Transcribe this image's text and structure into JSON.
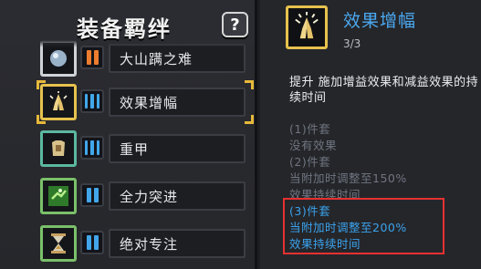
{
  "panel": {
    "title": "装备羁绊",
    "help_label": "?"
  },
  "bonds": [
    {
      "name": "大山蹒之难",
      "icon": "silver-orb-icon",
      "bar_color": "#ee7c2e",
      "selected": false
    },
    {
      "name": "效果增幅",
      "icon": "praying-hands-icon",
      "bar_color": "#41a7ea",
      "selected": true
    },
    {
      "name": "重甲",
      "icon": "heavy-armor-icon",
      "bar_color": "#41a7ea",
      "selected": false
    },
    {
      "name": "全力突进",
      "icon": "dash-icon",
      "bar_color": "#41a7ea",
      "selected": false
    },
    {
      "name": "绝对专注",
      "icon": "hourglass-icon",
      "bar_color": "#41a7ea",
      "selected": false
    }
  ],
  "detail": {
    "icon": "praying-hands-icon",
    "title": "效果增幅",
    "count": "3/3",
    "description": "提升 施加增益效果和减益效果的持续时间",
    "tiers": [
      {
        "label": "(1)件套",
        "text": "没有效果",
        "active": false
      },
      {
        "label": "(2)件套",
        "text": "当附加时调整至150%",
        "text2": "效果持续时间",
        "active": false
      },
      {
        "label": "(3)件套",
        "text": "当附加时调整至200%",
        "text2": "效果持续时间",
        "active": true
      }
    ]
  },
  "colors": {
    "accent_blue": "#4aa8f0",
    "highlight_gold": "#e6c24d",
    "active_red": "#e53131"
  }
}
